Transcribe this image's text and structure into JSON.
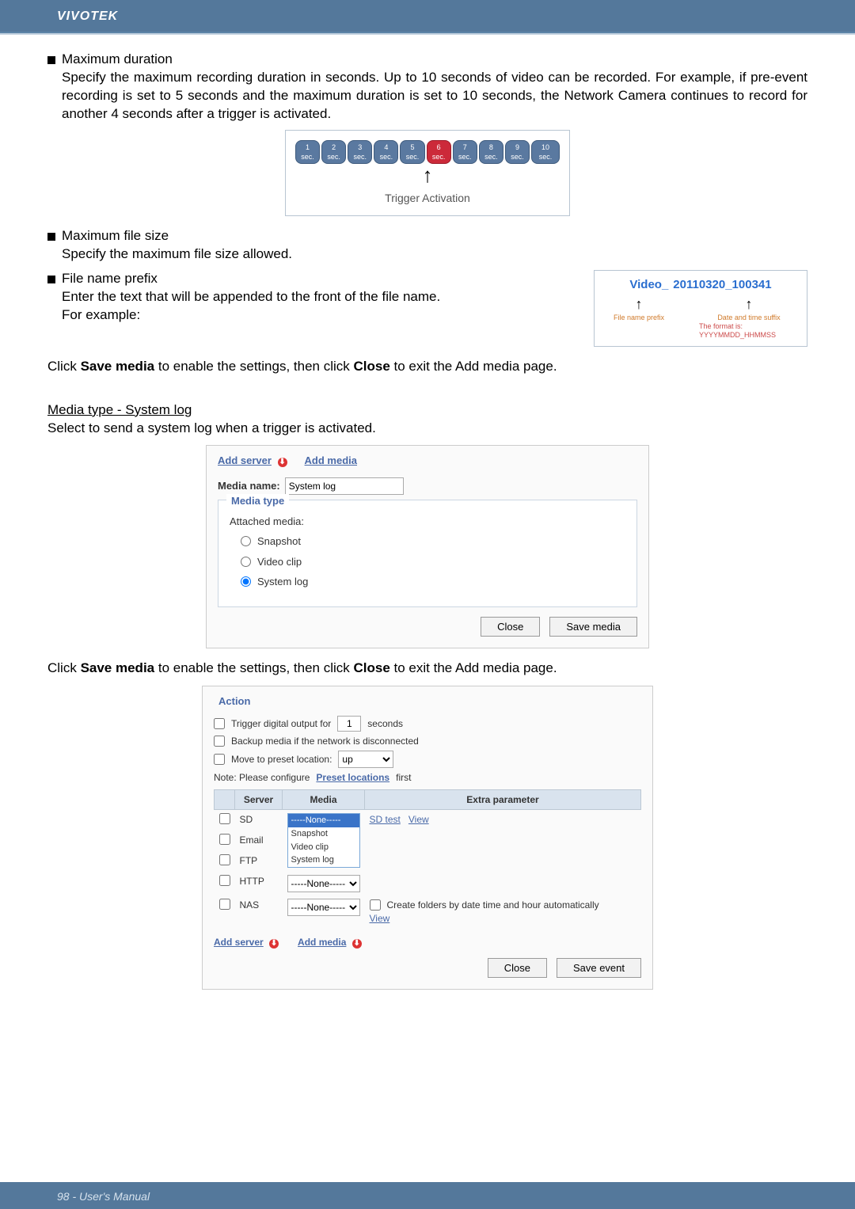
{
  "header": {
    "brand": "VIVOTEK"
  },
  "footer": {
    "page_label": "98 - User's Manual"
  },
  "sections": {
    "max_duration": {
      "title": "Maximum duration",
      "body": "Specify the maximum recording duration in seconds. Up to 10 seconds of video can be recorded. For example, if pre-event recording is set to 5 seconds and the maximum duration is set to 10 seconds, the Network Camera continues to record for another 4 seconds after a trigger is activated."
    },
    "timeline": {
      "pills": [
        "1 sec.",
        "2 sec.",
        "3 sec.",
        "4 sec.",
        "5 sec.",
        "6 sec.",
        "7 sec.",
        "8 sec.",
        "9 sec.",
        "10 sec."
      ],
      "active_index": 5,
      "caption": "Trigger Activation"
    },
    "max_filesize": {
      "title": "Maximum file size",
      "body": "Specify the maximum file size allowed."
    },
    "file_prefix": {
      "title": "File name prefix",
      "body1": "Enter the text that will be appended to the front of the file name.",
      "body2": " For example:"
    },
    "fname_example": {
      "prefix": "Video_",
      "suffix": "20110320_100341",
      "label_prefix": "File name prefix",
      "label_suffix": "Date and time suffix",
      "label_format": "The format is: YYYYMMDD_HHMMSS"
    },
    "click_save_media": "Click Save media to enable the settings, then click Close to exit the Add media page.",
    "systemlog_heading": "Media type - System log",
    "systemlog_desc": "Select to send a system log when a trigger is activated.",
    "click_save_media2": "Click Save media to enable the settings, then click Close to exit the Add media page."
  },
  "add_media_panel": {
    "tab_add_server": "Add server",
    "tab_add_media": "Add media",
    "media_name_label": "Media name:",
    "media_name_value": "System log",
    "fieldset_title": "Media type",
    "attached_media_label": "Attached media:",
    "radio_snapshot": "Snapshot",
    "radio_videoclip": "Video clip",
    "radio_systemlog": "System log",
    "btn_close": "Close",
    "btn_save": "Save media"
  },
  "action_panel": {
    "legend": "Action",
    "trigger_digital_label_pre": "Trigger digital output for",
    "trigger_digital_value": "1",
    "trigger_digital_label_post": "seconds",
    "backup_label": "Backup media if the network is disconnected",
    "move_preset_label": "Move to preset location:",
    "move_preset_value": "up",
    "note_pre": "Note: Please configure ",
    "note_link": "Preset locations",
    "note_post": " first",
    "table_headers": {
      "server": "Server",
      "media": "Media",
      "extra": "Extra parameter"
    },
    "rows": {
      "sd": {
        "name": "SD",
        "extra_sdtest": "SD test",
        "extra_view": "View"
      },
      "email": {
        "name": "Email"
      },
      "ftp": {
        "name": "FTP"
      },
      "http": {
        "name": "HTTP"
      },
      "nas": {
        "name": "NAS",
        "create_folders": "Create folders by date time and hour automatically",
        "view": "View"
      }
    },
    "media_select_none": "-----None-----",
    "media_options": [
      "-----None-----",
      "Snapshot",
      "Video clip",
      "System log"
    ],
    "add_server": "Add server",
    "add_media": "Add media",
    "btn_close": "Close",
    "btn_save": "Save event"
  }
}
